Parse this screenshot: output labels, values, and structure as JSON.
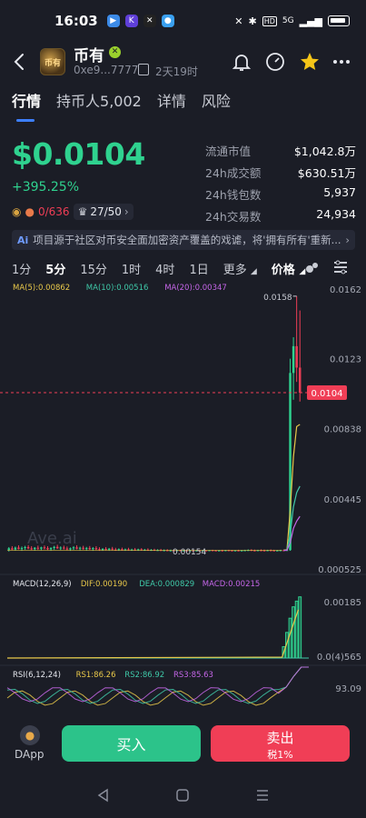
{
  "status": {
    "time": "16:03",
    "network": "HD",
    "signal": "5G",
    "apps": [
      "bili",
      "K",
      "okx",
      "chat"
    ]
  },
  "header": {
    "token_name": "币有",
    "avatar_text": "币有",
    "verified_mark": "✕",
    "address": "0xe9...7777",
    "age": "2天19时",
    "icons": [
      "back-icon",
      "bell-icon",
      "gauge-icon",
      "star-icon",
      "more-icon"
    ]
  },
  "tabs": [
    "行情",
    "持币人5,002",
    "详情",
    "风险"
  ],
  "price": {
    "value": "$0.0104",
    "change": "+395.25%",
    "badge1": "0/636",
    "badge2": "27/50"
  },
  "stats": [
    {
      "label": "流通市值",
      "value": "$1,042.8万"
    },
    {
      "label": "24h成交额",
      "value": "$630.51万"
    },
    {
      "label": "24h钱包数",
      "value": "5,937"
    },
    {
      "label": "24h交易数",
      "value": "24,934"
    }
  ],
  "notice": {
    "ai": "Ai",
    "text": "项目源于社区对币安全面加密资产覆盖的戏谑，将'拥有所有'重新..."
  },
  "timeframes": {
    "items": [
      "1分",
      "5分",
      "15分",
      "1时",
      "4时",
      "1日",
      "更多"
    ],
    "active": "5分",
    "price_toggle": "价格"
  },
  "chart_data": {
    "type": "candlestick",
    "ma_legend": [
      {
        "label": "MA(5):0.00862",
        "color": "#e8c84a"
      },
      {
        "label": "MA(10):0.00516",
        "color": "#3fc8a8"
      },
      {
        "label": "MA(20):0.00347",
        "color": "#c566e8"
      }
    ],
    "y_ticks": [
      "0.0162",
      "0.0123",
      "0.00838",
      "0.00445",
      "0.000525"
    ],
    "y_tick_values": [
      0.0162,
      0.0123,
      0.00838,
      0.00445,
      0.000525
    ],
    "current_price_label": "0.0104",
    "current_price": 0.0104,
    "high_label": "0.0158",
    "high": 0.0158,
    "low_label": "0.00154",
    "low": 0.00154,
    "watermark": "Ave.ai",
    "candles": [
      {
        "o": 0.0016,
        "h": 0.00175,
        "l": 0.0015,
        "c": 0.00168
      },
      {
        "o": 0.00168,
        "h": 0.0018,
        "l": 0.00158,
        "c": 0.00162
      },
      {
        "o": 0.00162,
        "h": 0.00178,
        "l": 0.00155,
        "c": 0.00172
      },
      {
        "o": 0.00172,
        "h": 0.00185,
        "l": 0.00162,
        "c": 0.00165
      },
      {
        "o": 0.00165,
        "h": 0.00178,
        "l": 0.00154,
        "c": 0.0017
      },
      {
        "o": 0.0017,
        "h": 0.00182,
        "l": 0.0016,
        "c": 0.00175
      },
      {
        "o": 0.00175,
        "h": 0.00186,
        "l": 0.00163,
        "c": 0.00168
      },
      {
        "o": 0.00168,
        "h": 0.0018,
        "l": 0.00158,
        "c": 0.00164
      },
      {
        "o": 0.00164,
        "h": 0.00175,
        "l": 0.00155,
        "c": 0.00171
      },
      {
        "o": 0.00171,
        "h": 0.00183,
        "l": 0.0016,
        "c": 0.00166
      },
      {
        "o": 0.00166,
        "h": 0.00177,
        "l": 0.00157,
        "c": 0.00173
      },
      {
        "o": 0.00173,
        "h": 0.00184,
        "l": 0.00162,
        "c": 0.00169
      },
      {
        "o": 0.00169,
        "h": 0.0018,
        "l": 0.00158,
        "c": 0.00163
      },
      {
        "o": 0.00163,
        "h": 0.00174,
        "l": 0.00154,
        "c": 0.0017
      },
      {
        "o": 0.0017,
        "h": 0.00182,
        "l": 0.0016,
        "c": 0.00176
      },
      {
        "o": 0.00176,
        "h": 0.00188,
        "l": 0.00165,
        "c": 0.00168
      },
      {
        "o": 0.00168,
        "h": 0.00179,
        "l": 0.00158,
        "c": 0.00172
      },
      {
        "o": 0.00172,
        "h": 0.00183,
        "l": 0.00161,
        "c": 0.00167
      },
      {
        "o": 0.00167,
        "h": 0.00178,
        "l": 0.00157,
        "c": 0.00162
      },
      {
        "o": 0.00162,
        "h": 0.00173,
        "l": 0.00154,
        "c": 0.00168
      },
      {
        "o": 0.00168,
        "h": 0.0018,
        "l": 0.00159,
        "c": 0.00173
      },
      {
        "o": 0.00173,
        "h": 0.00185,
        "l": 0.00162,
        "c": 0.00166
      },
      {
        "o": 0.00166,
        "h": 0.00177,
        "l": 0.00156,
        "c": 0.00171
      },
      {
        "o": 0.00171,
        "h": 0.00182,
        "l": 0.0016,
        "c": 0.00165
      },
      {
        "o": 0.00165,
        "h": 0.00176,
        "l": 0.00155,
        "c": 0.0017
      },
      {
        "o": 0.0017,
        "h": 0.00181,
        "l": 0.00159,
        "c": 0.00164
      },
      {
        "o": 0.00164,
        "h": 0.00175,
        "l": 0.00154,
        "c": 0.00169
      },
      {
        "o": 0.00169,
        "h": 0.0018,
        "l": 0.00158,
        "c": 0.00163
      },
      {
        "o": 0.00163,
        "h": 0.00174,
        "l": 0.00154,
        "c": 0.00158
      },
      {
        "o": 0.00158,
        "h": 0.00169,
        "l": 0.00154,
        "c": 0.00165
      },
      {
        "o": 0.00165,
        "h": 0.00175,
        "l": 0.00156,
        "c": 0.0016
      },
      {
        "o": 0.0016,
        "h": 0.0017,
        "l": 0.00154,
        "c": 0.00166
      },
      {
        "o": 0.00166,
        "h": 0.00176,
        "l": 0.00156,
        "c": 0.00161
      },
      {
        "o": 0.00161,
        "h": 0.00171,
        "l": 0.00154,
        "c": 0.00158
      },
      {
        "o": 0.00158,
        "h": 0.00168,
        "l": 0.00154,
        "c": 0.00163
      },
      {
        "o": 0.00163,
        "h": 0.00172,
        "l": 0.00155,
        "c": 0.00157
      },
      {
        "o": 0.00157,
        "h": 0.00167,
        "l": 0.00154,
        "c": 0.00162
      },
      {
        "o": 0.00162,
        "h": 0.00171,
        "l": 0.00155,
        "c": 0.00158
      },
      {
        "o": 0.00158,
        "h": 0.00166,
        "l": 0.00154,
        "c": 0.00161
      },
      {
        "o": 0.00161,
        "h": 0.0017,
        "l": 0.00155,
        "c": 0.00159
      },
      {
        "o": 0.00159,
        "h": 0.00166,
        "l": 0.00154,
        "c": 0.00162
      },
      {
        "o": 0.00162,
        "h": 0.00169,
        "l": 0.00155,
        "c": 0.00158
      },
      {
        "o": 0.00158,
        "h": 0.00165,
        "l": 0.00154,
        "c": 0.0016
      },
      {
        "o": 0.0016,
        "h": 0.00168,
        "l": 0.00154,
        "c": 0.00157
      },
      {
        "o": 0.00157,
        "h": 0.00164,
        "l": 0.00154,
        "c": 0.00159
      },
      {
        "o": 0.00159,
        "h": 0.00166,
        "l": 0.00154,
        "c": 0.00156
      },
      {
        "o": 0.00156,
        "h": 0.00163,
        "l": 0.00154,
        "c": 0.00158
      },
      {
        "o": 0.00158,
        "h": 0.00165,
        "l": 0.00154,
        "c": 0.00155
      },
      {
        "o": 0.00155,
        "h": 0.00162,
        "l": 0.00154,
        "c": 0.00157
      },
      {
        "o": 0.00157,
        "h": 0.00163,
        "l": 0.00154,
        "c": 0.00155
      },
      {
        "o": 0.00155,
        "h": 0.00161,
        "l": 0.00154,
        "c": 0.00156
      },
      {
        "o": 0.00156,
        "h": 0.0016,
        "l": 0.00154,
        "c": 0.00155
      },
      {
        "o": 0.00155,
        "h": 0.0016,
        "l": 0.00154,
        "c": 0.00157
      },
      {
        "o": 0.00157,
        "h": 0.0016,
        "l": 0.00154,
        "c": 0.00155
      },
      {
        "o": 0.00155,
        "h": 0.00159,
        "l": 0.00154,
        "c": 0.00156
      },
      {
        "o": 0.00156,
        "h": 0.00159,
        "l": 0.00154,
        "c": 0.00155
      },
      {
        "o": 0.00155,
        "h": 0.00158,
        "l": 0.00154,
        "c": 0.00156
      },
      {
        "o": 0.00156,
        "h": 0.00158,
        "l": 0.00154,
        "c": 0.00155
      },
      {
        "o": 0.00155,
        "h": 0.00158,
        "l": 0.00154,
        "c": 0.00156
      },
      {
        "o": 0.00156,
        "h": 0.00158,
        "l": 0.00154,
        "c": 0.00155
      },
      {
        "o": 0.00155,
        "h": 0.00158,
        "l": 0.00154,
        "c": 0.00156
      },
      {
        "o": 0.00156,
        "h": 0.00158,
        "l": 0.00154,
        "c": 0.00155
      },
      {
        "o": 0.00155,
        "h": 0.00158,
        "l": 0.00154,
        "c": 0.00157
      },
      {
        "o": 0.00157,
        "h": 0.0016,
        "l": 0.00154,
        "c": 0.00156
      },
      {
        "o": 0.00156,
        "h": 0.00159,
        "l": 0.00154,
        "c": 0.00155
      },
      {
        "o": 0.00155,
        "h": 0.00158,
        "l": 0.00154,
        "c": 0.00156
      },
      {
        "o": 0.00156,
        "h": 0.0016,
        "l": 0.00154,
        "c": 0.00155
      },
      {
        "o": 0.00155,
        "h": 0.00159,
        "l": 0.00154,
        "c": 0.00157
      },
      {
        "o": 0.00157,
        "h": 0.0016,
        "l": 0.00154,
        "c": 0.00156
      },
      {
        "o": 0.00156,
        "h": 0.00159,
        "l": 0.00154,
        "c": 0.00155
      },
      {
        "o": 0.00155,
        "h": 0.00158,
        "l": 0.00154,
        "c": 0.00156
      },
      {
        "o": 0.00156,
        "h": 0.0016,
        "l": 0.00154,
        "c": 0.00155
      },
      {
        "o": 0.00155,
        "h": 0.00159,
        "l": 0.00154,
        "c": 0.00156
      },
      {
        "o": 0.00156,
        "h": 0.0016,
        "l": 0.00154,
        "c": 0.00157
      },
      {
        "o": 0.00157,
        "h": 0.00162,
        "l": 0.00154,
        "c": 0.00158
      },
      {
        "o": 0.00158,
        "h": 0.00163,
        "l": 0.00155,
        "c": 0.00156
      },
      {
        "o": 0.00156,
        "h": 0.00161,
        "l": 0.00154,
        "c": 0.00155
      },
      {
        "o": 0.00155,
        "h": 0.0016,
        "l": 0.00154,
        "c": 0.00157
      },
      {
        "o": 0.00157,
        "h": 0.00162,
        "l": 0.00154,
        "c": 0.00156
      },
      {
        "o": 0.00156,
        "h": 0.00161,
        "l": 0.00154,
        "c": 0.00155
      },
      {
        "o": 0.00155,
        "h": 0.0016,
        "l": 0.00154,
        "c": 0.00157
      },
      {
        "o": 0.00157,
        "h": 0.00162,
        "l": 0.00154,
        "c": 0.00156
      },
      {
        "o": 0.00156,
        "h": 0.0016,
        "l": 0.00154,
        "c": 0.00155
      },
      {
        "o": 0.00155,
        "h": 0.00159,
        "l": 0.00154,
        "c": 0.00156
      },
      {
        "o": 0.00156,
        "h": 0.0016,
        "l": 0.00154,
        "c": 0.00157
      },
      {
        "o": 0.00157,
        "h": 0.00161,
        "l": 0.00155,
        "c": 0.00156
      },
      {
        "o": 0.00156,
        "h": 0.0016,
        "l": 0.00154,
        "c": 0.00158
      },
      {
        "o": 0.00158,
        "h": 0.0123,
        "l": 0.00154,
        "c": 0.0115
      },
      {
        "o": 0.0115,
        "h": 0.0135,
        "l": 0.01,
        "c": 0.013
      },
      {
        "o": 0.013,
        "h": 0.0158,
        "l": 0.011,
        "c": 0.0118
      },
      {
        "o": 0.0118,
        "h": 0.015,
        "l": 0.0099,
        "c": 0.0104
      }
    ],
    "ma_values": {
      "ma5_tail": [
        0.00158,
        0.0016,
        0.0038,
        0.0068,
        0.0085,
        0.00862
      ],
      "ma10_tail": [
        0.00157,
        0.00158,
        0.0025,
        0.004,
        0.0048,
        0.00516
      ],
      "ma20_tail": [
        0.00156,
        0.00157,
        0.002,
        0.0028,
        0.0032,
        0.00347
      ]
    },
    "macd": {
      "legend": [
        {
          "label": "MACD(12,26,9)",
          "color": "#e6e8ee"
        },
        {
          "label": "DIF:0.00190",
          "color": "#e8c84a"
        },
        {
          "label": "DEA:0.000829",
          "color": "#3fc8a8"
        },
        {
          "label": "MACD:0.00215",
          "color": "#c566e8"
        }
      ],
      "y_ticks": [
        "0.00185",
        "0.0(4)565"
      ],
      "bars": [
        0.0004,
        0.0009,
        0.0014,
        0.0018,
        0.002,
        0.00215
      ]
    },
    "rsi": {
      "legend": [
        {
          "label": "RSI(6,12,24)",
          "color": "#e6e8ee"
        },
        {
          "label": "RS1:86.26",
          "color": "#e8c84a"
        },
        {
          "label": "RS2:86.92",
          "color": "#3fc8a8"
        },
        {
          "label": "RS3:85.63",
          "color": "#c566e8"
        }
      ],
      "y_tick": "93.09"
    }
  },
  "actions": {
    "dapp": "DApp",
    "buy": "买入",
    "sell": "卖出",
    "sell_tax": "税1%"
  },
  "colors": {
    "up": "#2fd28f",
    "down": "#f03e56",
    "bg": "#1b1d26",
    "accent": "#3d7fff"
  }
}
